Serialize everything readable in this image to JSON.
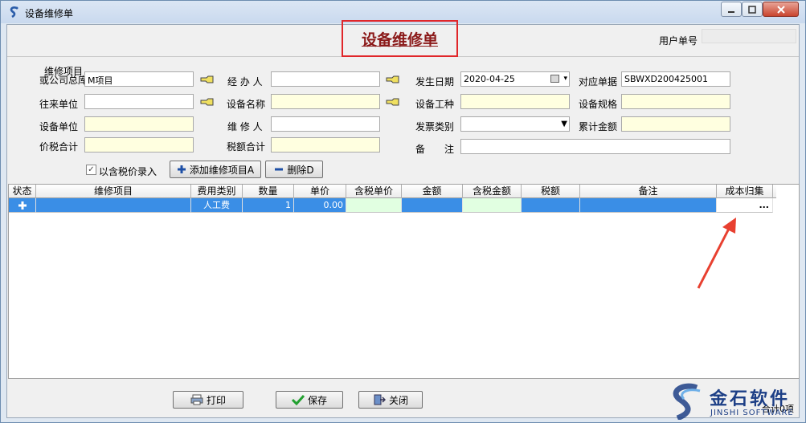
{
  "window": {
    "title": "设备维修单"
  },
  "header": {
    "form_title": "设备维修单",
    "user_no_label": "用户单号",
    "user_no_value": ""
  },
  "fields": {
    "repair_item_label_line1": "维修项目",
    "repair_item_label_line2": "或公司总库",
    "repair_item_value": "M项目",
    "counterparty_label": "往来单位",
    "counterparty_value": "",
    "equip_unit_label": "设备单位",
    "equip_unit_value": "",
    "price_tax_total_label": "价税合计",
    "price_tax_total_value": "",
    "handler_label": "经 办 人",
    "handler_value": "",
    "equip_name_label": "设备名称",
    "equip_name_value": "",
    "repairer_label": "维 修 人",
    "repairer_value": "",
    "tax_total_label": "税额合计",
    "tax_total_value": "",
    "date_label": "发生日期",
    "date_value": "2020-04-25",
    "equip_type_label": "设备工种",
    "equip_type_value": "",
    "invoice_type_label": "发票类别",
    "invoice_type_value": "",
    "remark_label": "备　　注",
    "remark_value": "",
    "ref_no_label": "对应单据",
    "ref_no_value": "SBWXD200425001",
    "spec_label": "设备规格",
    "spec_value": "",
    "accum_amount_label": "累计金额",
    "accum_amount_value": ""
  },
  "options": {
    "tax_included_label": "以含税价录入",
    "tax_included_checked": true
  },
  "buttons": {
    "add_item": "添加维修项目A",
    "delete": "删除D",
    "print": "打印",
    "save": "保存",
    "close": "关闭"
  },
  "grid": {
    "columns": [
      "状态",
      "维修项目",
      "费用类别",
      "数量",
      "单价",
      "含税单价",
      "金额",
      "含税金额",
      "税额",
      "备注",
      "成本归集"
    ],
    "rows": [
      {
        "status_icon": "plus-icon",
        "item": "",
        "fee_type": "人工费",
        "qty": "1",
        "unit_price": "0.00",
        "tax_unit_price": "",
        "amount": "",
        "tax_amount": "",
        "tax": "",
        "remark": "",
        "cost_collect": "..."
      }
    ]
  },
  "footer": {
    "total_label": "合计0项"
  },
  "logo": {
    "cn": "金石软件",
    "en": "JINSHI SOFTWARE"
  },
  "colors": {
    "title_highlight": "#e0262a",
    "selected_row": "#3a8ee6",
    "input_readonly": "#ffffe0",
    "arrow": "#e84030"
  }
}
